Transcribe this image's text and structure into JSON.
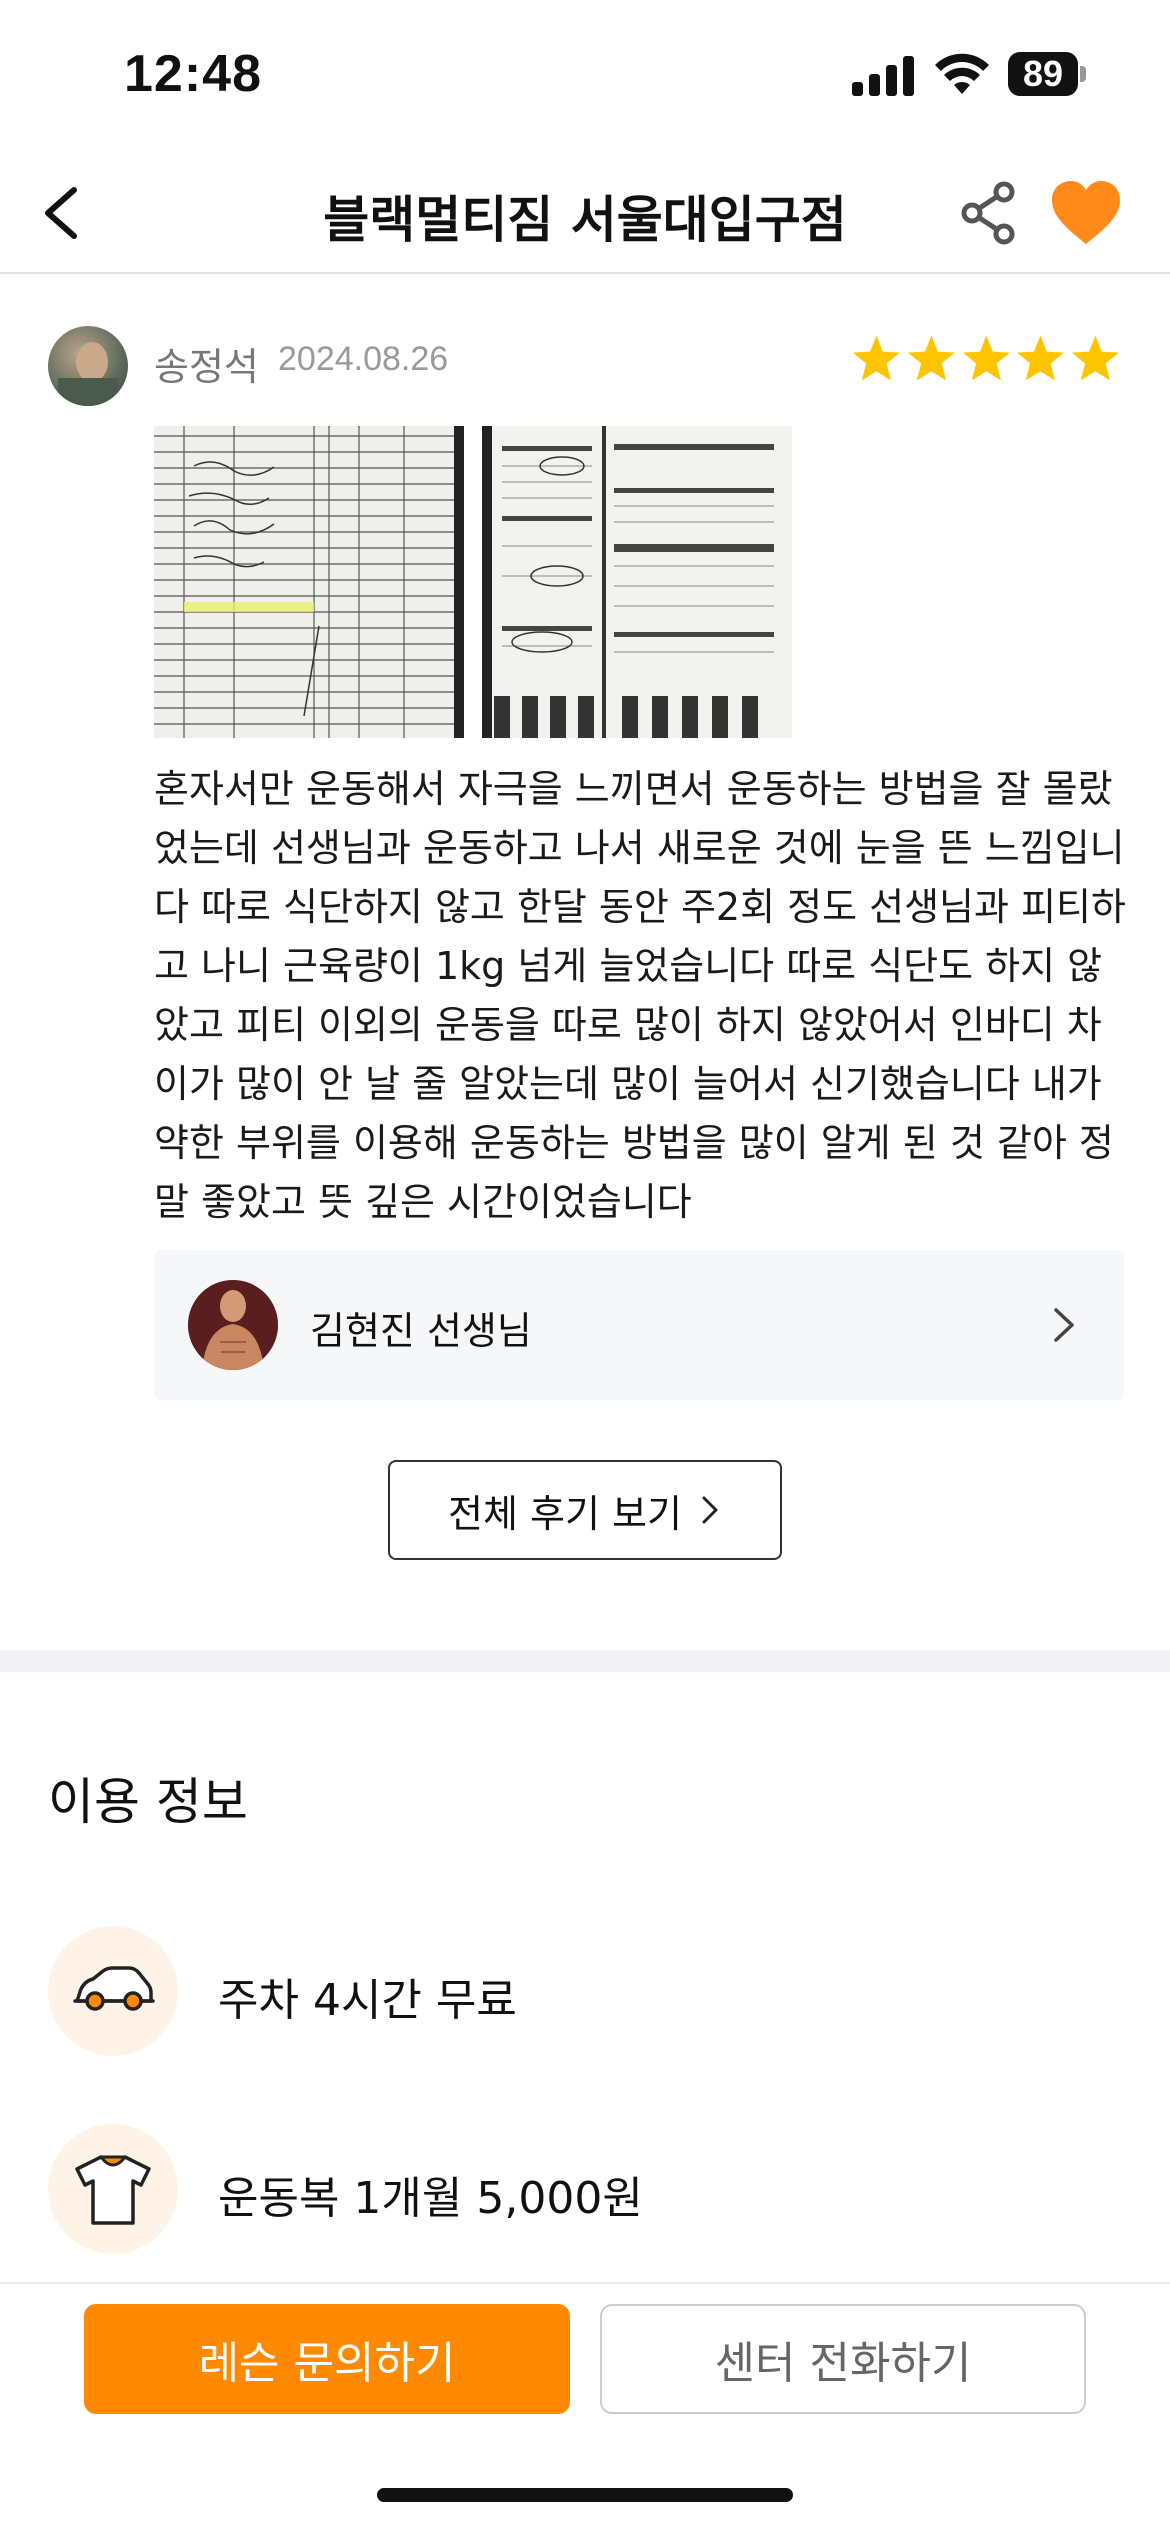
{
  "status_bar": {
    "time": "12:48",
    "battery": "89"
  },
  "header": {
    "title": "블랙멀티짐 서울대입구점"
  },
  "review": {
    "reviewer_name": "송정석",
    "date": "2024.08.26",
    "rating": 5,
    "rating_max": 5,
    "text": "혼자서만 운동해서 자극을 느끼면서 운동하는 방법을 잘 몰랐었는데 선생님과 운동하고 나서 새로운 것에 눈을 뜬 느낌입니다 따로 식단하지 않고 한달 동안 주2회 정도 선생님과 피티하고 나니 근육량이 1kg 넘게 늘었습니다 따로 식단도 하지 않았고 피티 이외의 운동을 따로 많이 하지 않았어서 인바디 차이가 많이 안 날 줄 알았는데 많이 늘어서 신기했습니다 내가 약한 부위를 이용해 운동하는 방법을 많이 알게 된 것 같아 정말 좋았고 뜻 깊은 시간이었습니다",
    "trainer_name": "김현진 선생님",
    "all_reviews_label": "전체 후기 보기"
  },
  "info": {
    "title": "이용 정보",
    "items": [
      {
        "icon": "car-icon",
        "label": "주차 4시간 무료"
      },
      {
        "icon": "tshirt-icon",
        "label": "운동복 1개월 5,000원"
      }
    ]
  },
  "bottom_bar": {
    "inquiry_label": "레슨 문의하기",
    "call_label": "센터 전화하기"
  },
  "colors": {
    "accent": "#ff8a00",
    "star": "#ffc400",
    "icon_bg": "#fff3e8"
  }
}
